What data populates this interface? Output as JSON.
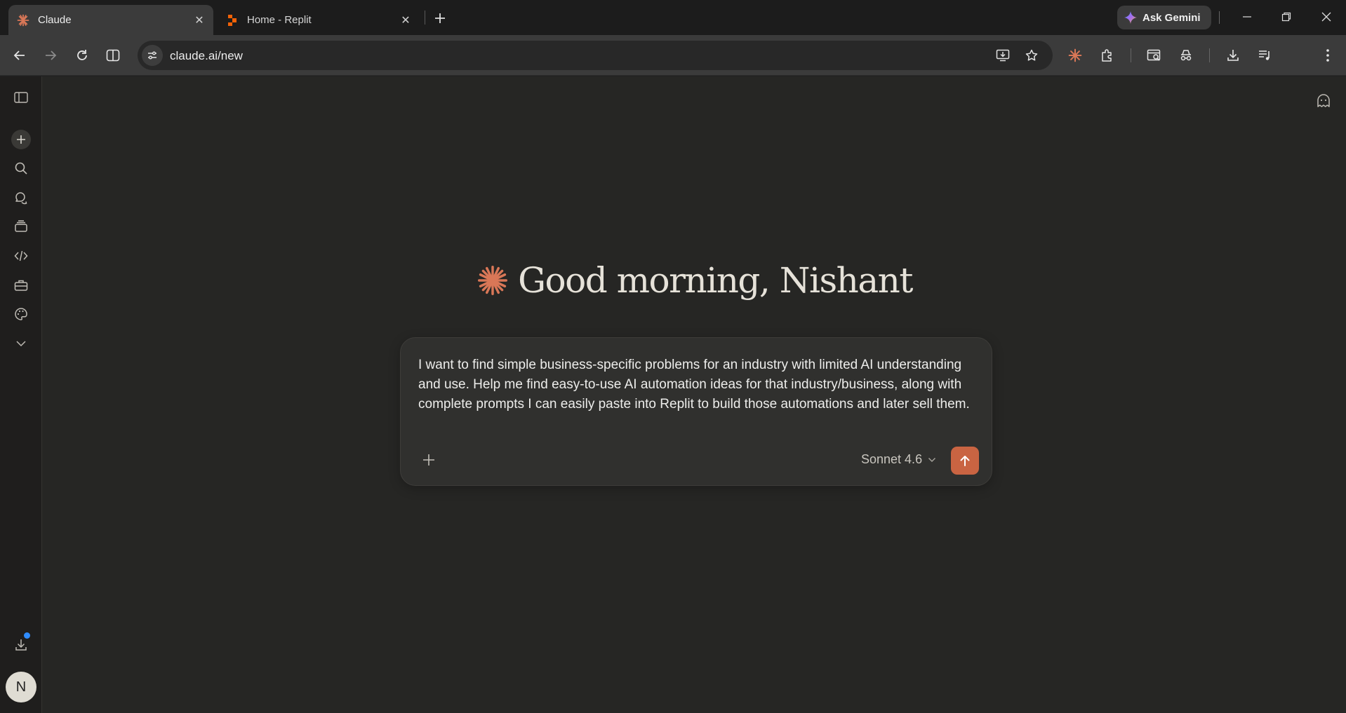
{
  "browser": {
    "tabs": [
      {
        "title": "Claude",
        "active": true,
        "icon": "claude-spark-icon"
      },
      {
        "title": "Home - Replit",
        "active": false,
        "icon": "replit-icon"
      }
    ],
    "ask_gemini_label": "Ask Gemini",
    "url": "claude.ai/new"
  },
  "claude": {
    "greeting": "Good morning, Nishant",
    "prompt_text": "I want to find simple business-specific problems for an industry with limited AI understanding and use. Help me find easy-to-use AI automation ideas for that industry/business, along with complete prompts I can easily paste into Replit to build those automations and later sell them.",
    "model_label": "Sonnet 4.6",
    "user_initial": "N",
    "sidebar_icons": [
      "sidebar-toggle-icon",
      "new-chat-icon",
      "search-icon",
      "chats-icon",
      "projects-icon",
      "code-icon",
      "artifacts-icon",
      "palette-icon",
      "chevron-down-icon",
      "download-icon"
    ]
  },
  "colors": {
    "accent": "#c96442",
    "background": "#262624",
    "composer": "#30302e"
  }
}
